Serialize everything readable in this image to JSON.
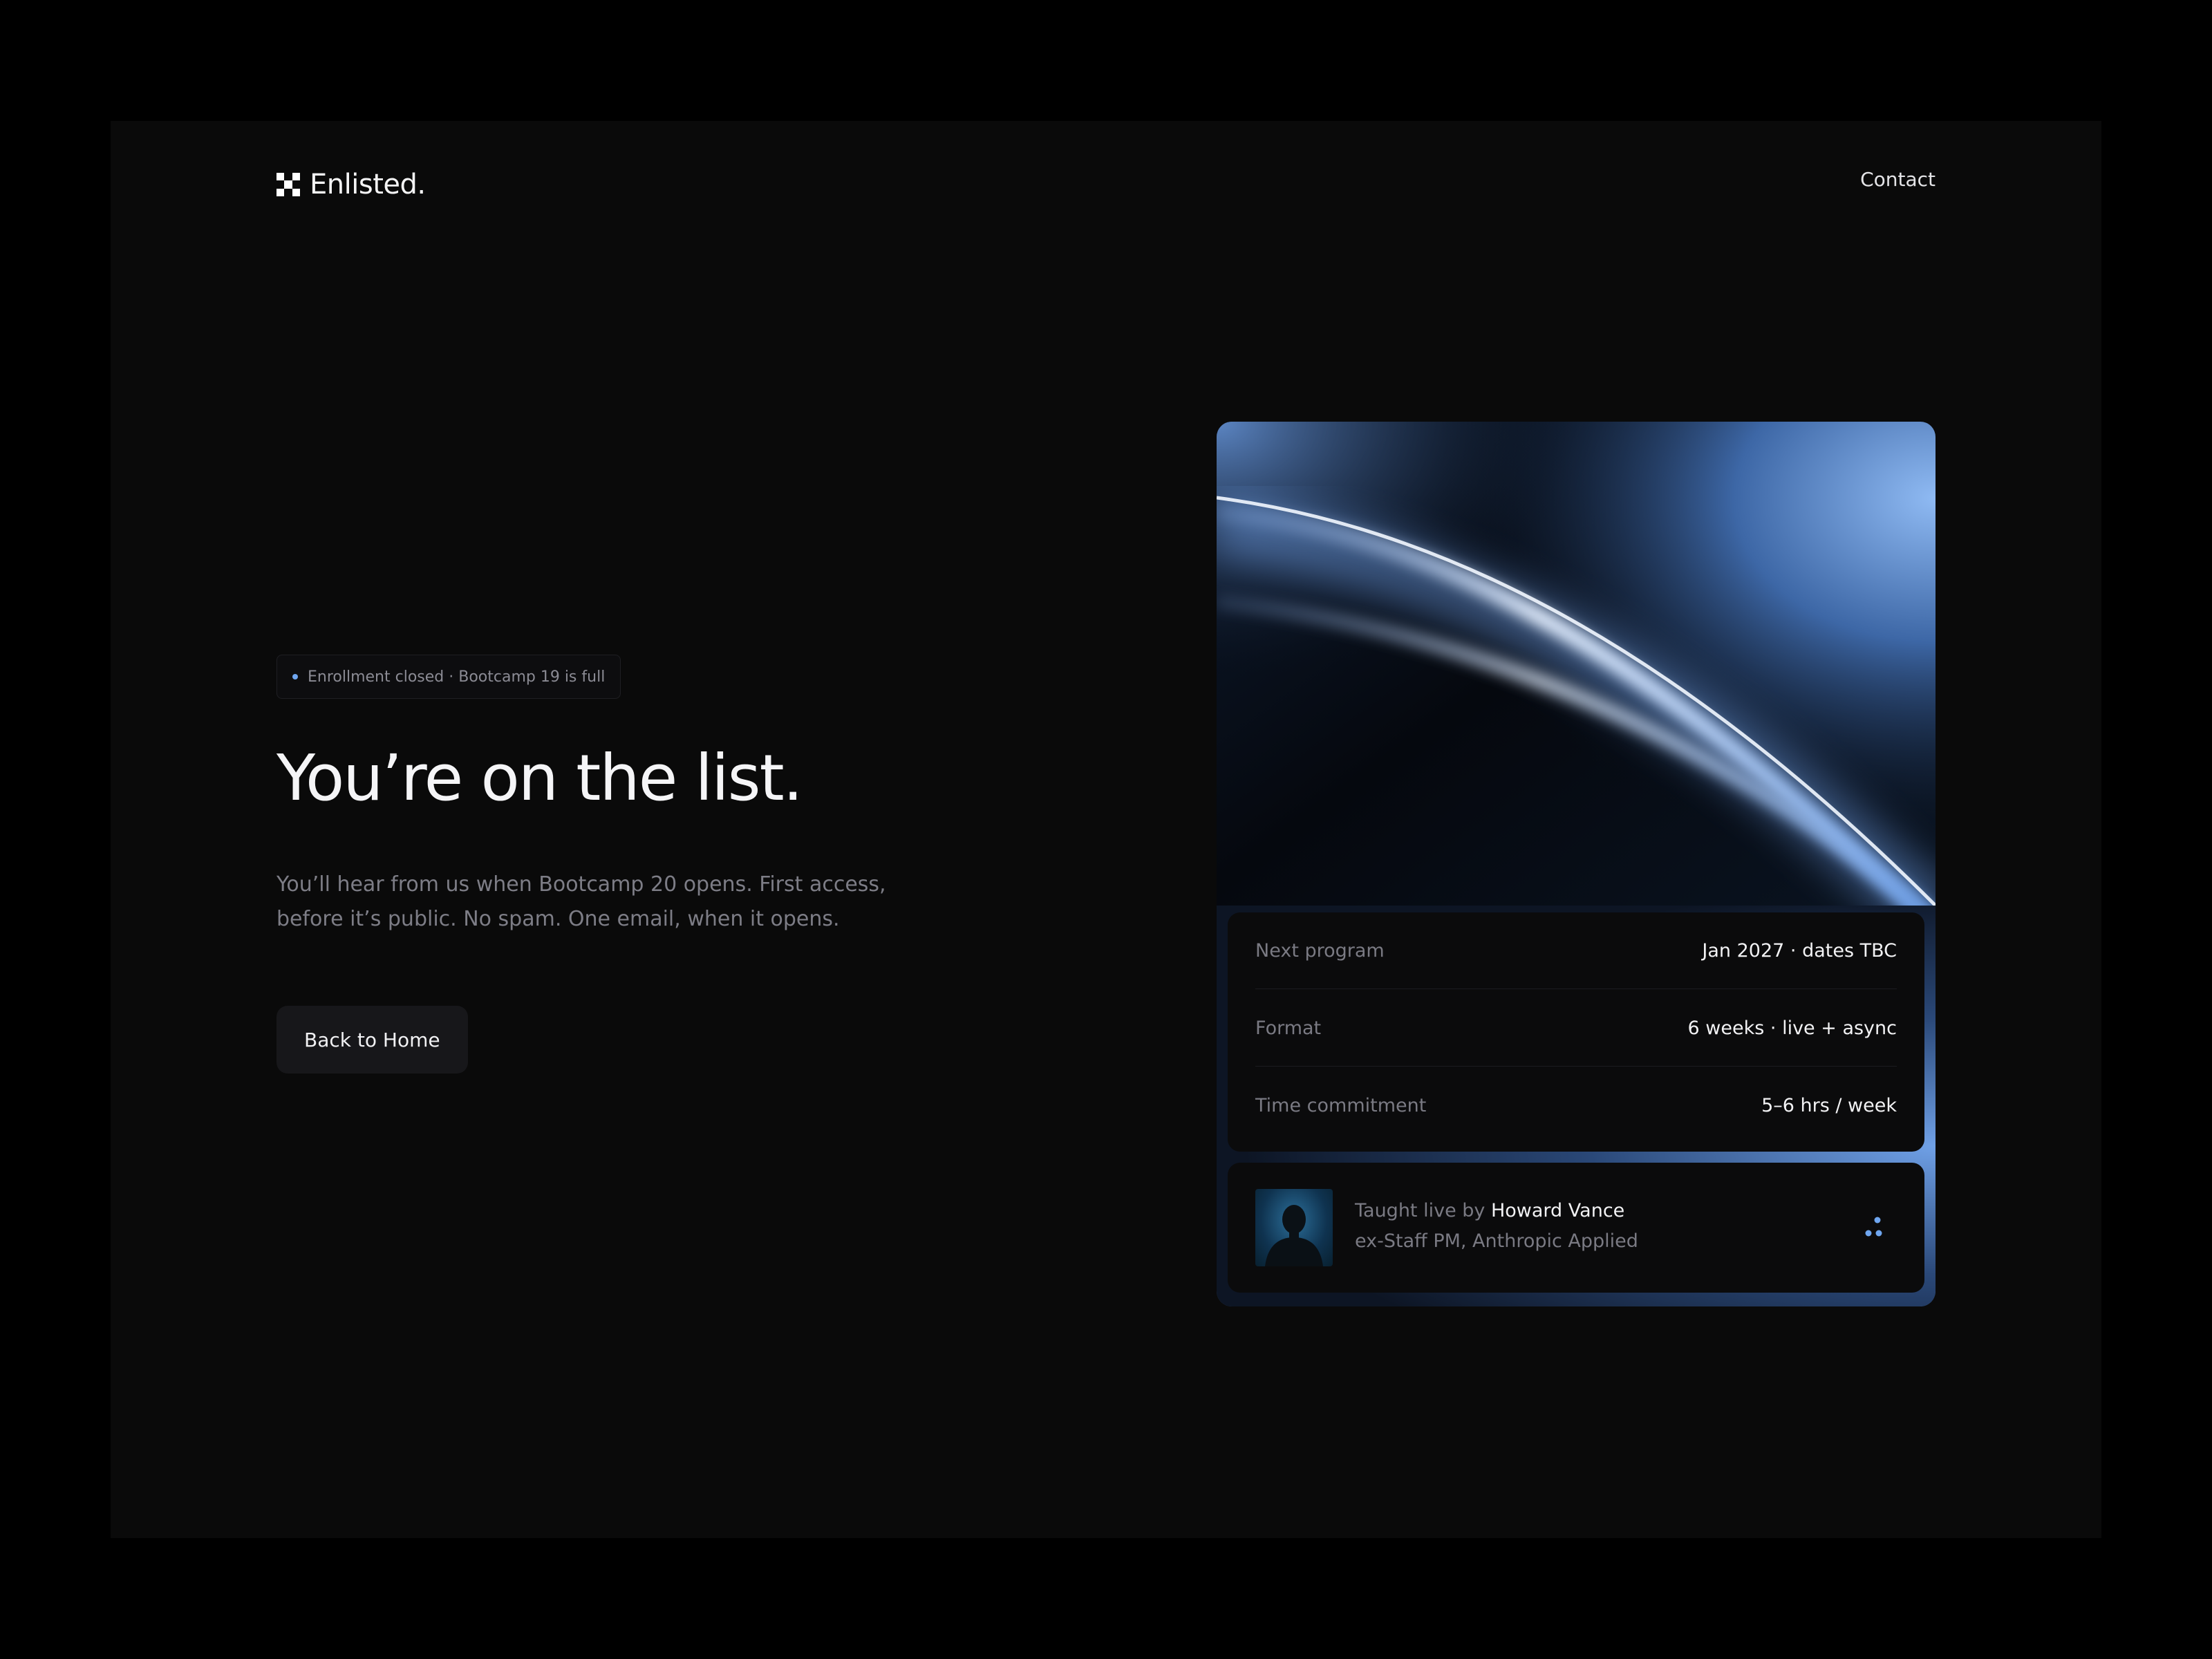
{
  "header": {
    "brand": "Enlisted.",
    "contact_label": "Contact"
  },
  "hero": {
    "badge": "Enrollment closed · Bootcamp 19 is full",
    "title": "You’re on the list.",
    "subtitle": "You’ll hear from us when Bootcamp 20 opens. First access, before it’s public. No spam. One email, when it opens.",
    "back_button": "Back to Home"
  },
  "program": {
    "rows": [
      {
        "label": "Next program",
        "value": "Jan 2027 · dates TBC"
      },
      {
        "label": "Format",
        "value": "6 weeks · live + async"
      },
      {
        "label": "Time commitment",
        "value": "5–6 hrs / week"
      }
    ]
  },
  "instructor": {
    "prefix": "Taught live by ",
    "name": "Howard Vance",
    "role": "ex-Staff PM, Anthropic Applied"
  },
  "icons": {
    "logo": "checker-logo-icon",
    "status": "status-dot-icon",
    "more": "dots-icon"
  },
  "colors": {
    "background": "#0a0a0a",
    "accent": "#6fa6f0",
    "text_primary": "#f5f5f7",
    "text_muted": "#7d7d86"
  }
}
